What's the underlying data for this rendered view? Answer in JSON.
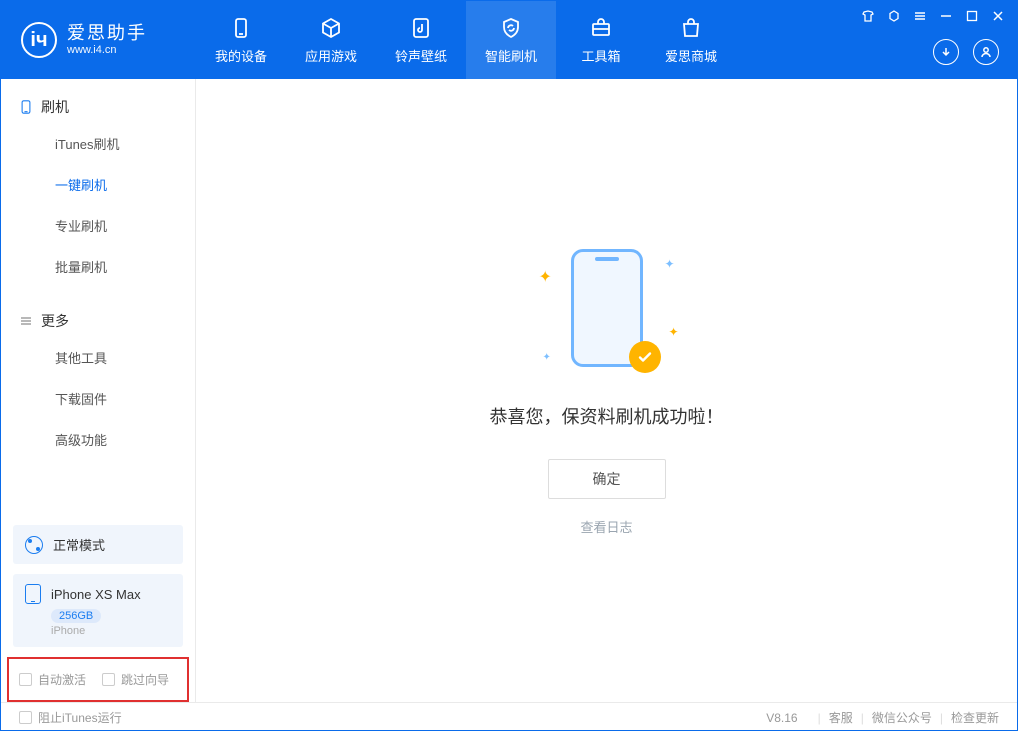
{
  "app": {
    "title": "爱思助手",
    "url": "www.i4.cn"
  },
  "header": {
    "tabs": [
      {
        "label": "我的设备"
      },
      {
        "label": "应用游戏"
      },
      {
        "label": "铃声壁纸"
      },
      {
        "label": "智能刷机"
      },
      {
        "label": "工具箱"
      },
      {
        "label": "爱思商城"
      }
    ]
  },
  "sidebar": {
    "section1": {
      "title": "刷机",
      "items": [
        "iTunes刷机",
        "一键刷机",
        "专业刷机",
        "批量刷机"
      ]
    },
    "section2": {
      "title": "更多",
      "items": [
        "其他工具",
        "下载固件",
        "高级功能"
      ]
    },
    "mode": "正常模式",
    "device": {
      "name": "iPhone XS Max",
      "storage": "256GB",
      "type": "iPhone"
    },
    "checks": {
      "autoActivate": "自动激活",
      "skipGuide": "跳过向导"
    }
  },
  "main": {
    "success": "恭喜您，保资料刷机成功啦！",
    "confirm": "确定",
    "viewLog": "查看日志"
  },
  "footer": {
    "blockItunes": "阻止iTunes运行",
    "version": "V8.16",
    "links": [
      "客服",
      "微信公众号",
      "检查更新"
    ]
  }
}
